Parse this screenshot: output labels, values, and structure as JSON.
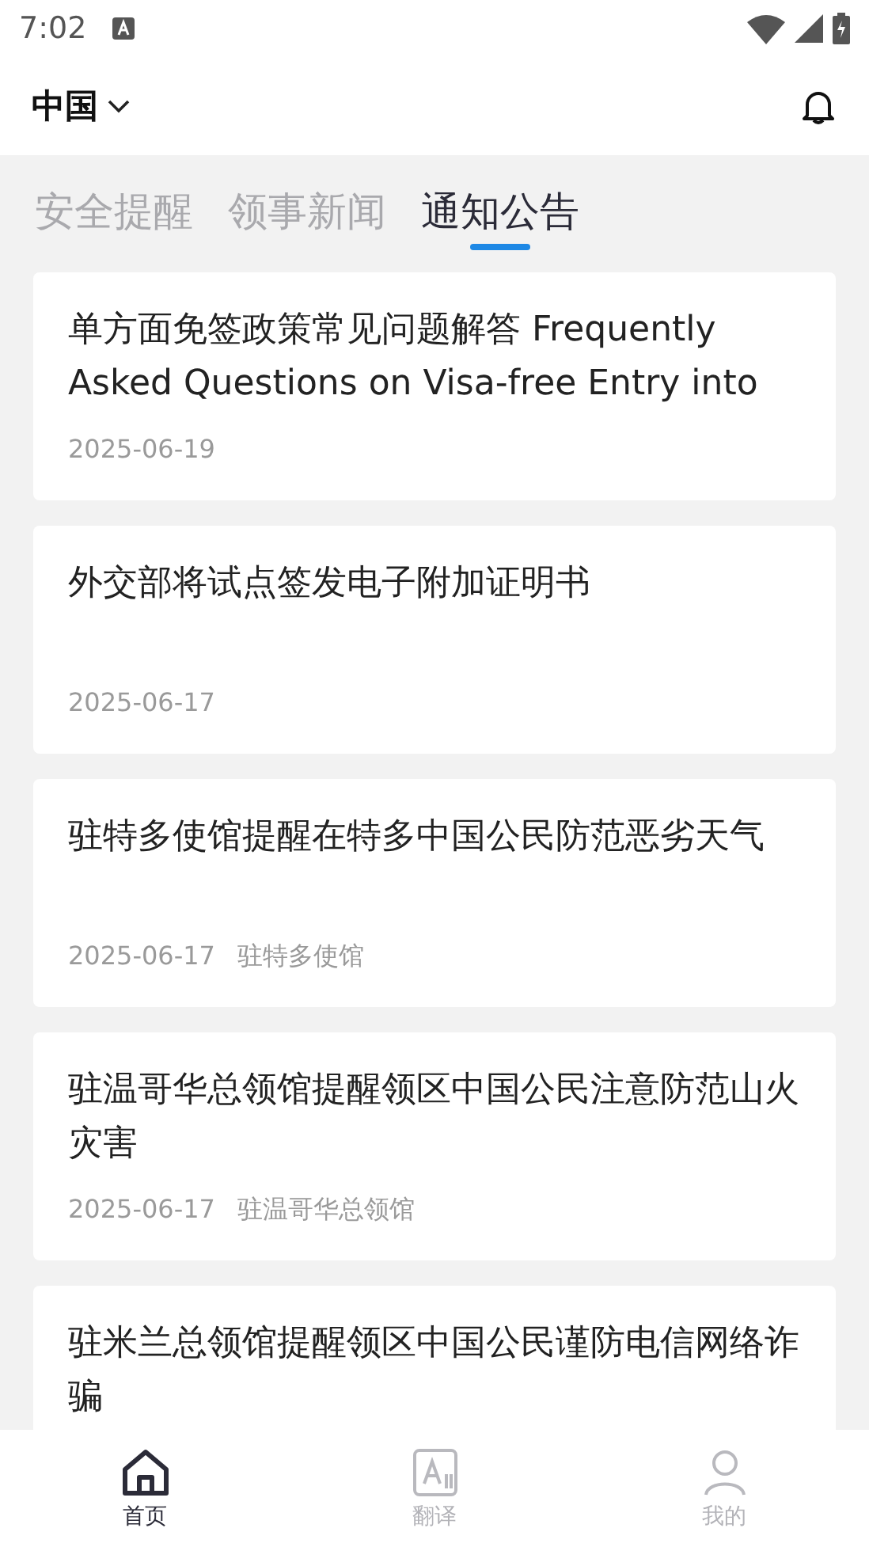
{
  "status_bar": {
    "time": "7:02"
  },
  "header": {
    "region": "中国"
  },
  "tabs": [
    {
      "label": "安全提醒",
      "selected": false
    },
    {
      "label": "领事新闻",
      "selected": false
    },
    {
      "label": "通知公告",
      "selected": true
    }
  ],
  "articles": [
    {
      "title": "单方面免签政策常见问题解答 Frequently Asked Questions on Visa-free Entry into",
      "date": "2025-06-19"
    },
    {
      "title": "外交部将试点签发电子附加证明书",
      "date": "2025-06-17"
    },
    {
      "title": "驻特多使馆提醒在特多中国公民防范恶劣天气",
      "date": "2025-06-17",
      "source": "驻特多使馆"
    },
    {
      "title": "驻温哥华总领馆提醒领区中国公民注意防范山火灾害",
      "date": "2025-06-17",
      "source": "驻温哥华总领馆"
    },
    {
      "title": "驻米兰总领馆提醒领区中国公民谨防电信网络诈骗"
    }
  ],
  "bottom_nav": [
    {
      "label": "首页",
      "kind": "home",
      "selected": true
    },
    {
      "label": "翻译",
      "kind": "translate",
      "selected": false
    },
    {
      "label": "我的",
      "kind": "profile",
      "selected": false
    }
  ]
}
